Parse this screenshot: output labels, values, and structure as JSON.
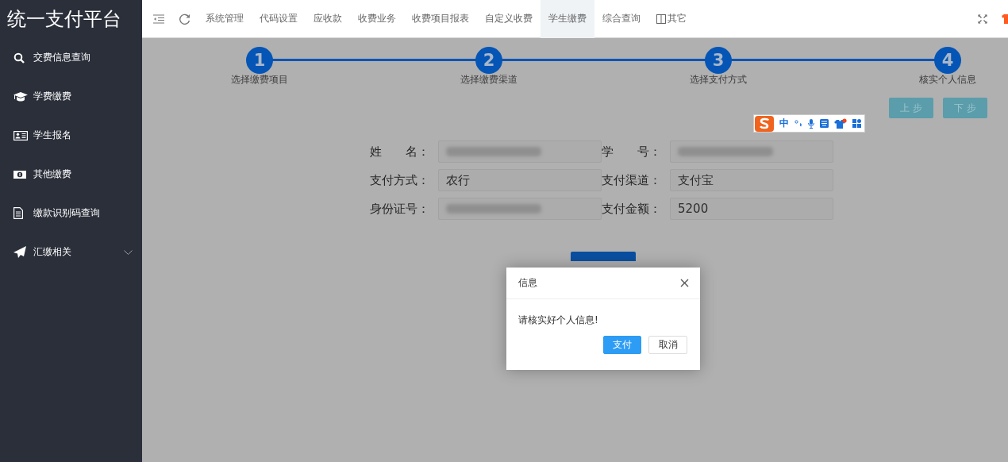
{
  "brand": "统一支付平台",
  "sidebar": {
    "items": [
      {
        "label": "交费信息查询",
        "has_submenu": false
      },
      {
        "label": "学费缴费",
        "has_submenu": false
      },
      {
        "label": "学生报名",
        "has_submenu": false
      },
      {
        "label": "其他缴费",
        "has_submenu": false
      },
      {
        "label": "缴款识别码查询",
        "has_submenu": false
      },
      {
        "label": "汇缴相关",
        "has_submenu": true
      }
    ]
  },
  "topbar": {
    "tabs": [
      {
        "label": "系统管理",
        "selected": false
      },
      {
        "label": "代码设置",
        "selected": false
      },
      {
        "label": "应收款",
        "selected": false
      },
      {
        "label": "收费业务",
        "selected": false
      },
      {
        "label": "收费项目报表",
        "selected": false
      },
      {
        "label": "自定义收费",
        "selected": false
      },
      {
        "label": "学生缴费",
        "selected": true
      },
      {
        "label": "综合查询",
        "selected": false
      },
      {
        "label": "其它",
        "selected": false,
        "kind": "columns"
      }
    ]
  },
  "steps": [
    {
      "number": "1",
      "label": "选择缴费项目"
    },
    {
      "number": "2",
      "label": "选择缴费渠道"
    },
    {
      "number": "3",
      "label": "选择支付方式"
    },
    {
      "number": "4",
      "label": "核实个人信息"
    }
  ],
  "nav_buttons": [
    "上 步",
    "下 步"
  ],
  "ime_bar": {
    "mode": "中"
  },
  "form": {
    "fields": [
      {
        "label": "姓　　名：",
        "redacted": true
      },
      {
        "label": "学　　号：",
        "redacted": true
      },
      {
        "label": "支付方式：",
        "value": "农行",
        "redacted": false
      },
      {
        "label": "支付渠道：",
        "value": "支付宝",
        "redacted": false
      },
      {
        "label": "身份证号：",
        "redacted": true
      },
      {
        "label": "支付金额：",
        "value": "5200",
        "redacted": false
      }
    ]
  },
  "dialog": {
    "title": "信息",
    "message": "请核实好个人信息!",
    "buttons": [
      {
        "label": "支付",
        "kind": "primary"
      },
      {
        "label": "取消",
        "kind": "secondary"
      }
    ]
  }
}
